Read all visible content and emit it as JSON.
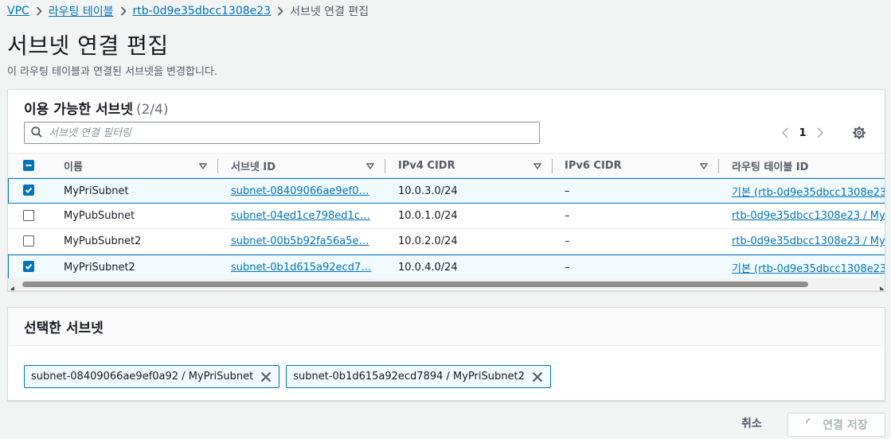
{
  "breadcrumb": {
    "items": [
      "VPC",
      "라우팅 테이블",
      "rtb-0d9e35dbcc1308e23"
    ],
    "current": "서브넷 연결 편집"
  },
  "page": {
    "title": "서브넷 연결 편집",
    "description": "이 라우팅 테이블과 연결된 서브넷을 변경합니다."
  },
  "available": {
    "title": "이용 가능한 서브넷",
    "count": "(2/4)",
    "filter_placeholder": "서브넷 연결 필터링",
    "page": "1",
    "columns": [
      "이름",
      "서브넷 ID",
      "IPv4 CIDR",
      "IPv6 CIDR",
      "라우팅 테이블 ID"
    ],
    "rows": [
      {
        "checked": true,
        "name": "MyPriSubnet",
        "subnet_id": "subnet-08409066ae9ef0…",
        "ipv4": "10.0.3.0/24",
        "ipv6": "–",
        "route": "기본 (rtb-0d9e35dbcc1308e23"
      },
      {
        "checked": false,
        "name": "MyPubSubnet",
        "subnet_id": "subnet-04ed1ce798ed1c…",
        "ipv4": "10.0.1.0/24",
        "ipv6": "–",
        "route": "rtb-0d9e35dbcc1308e23 / My"
      },
      {
        "checked": false,
        "name": "MyPubSubnet2",
        "subnet_id": "subnet-00b5b92fa56a5e…",
        "ipv4": "10.0.2.0/24",
        "ipv6": "–",
        "route": "rtb-0d9e35dbcc1308e23 / My"
      },
      {
        "checked": true,
        "name": "MyPriSubnet2",
        "subnet_id": "subnet-0b1d615a92ecd7…",
        "ipv4": "10.0.4.0/24",
        "ipv6": "–",
        "route": "기본 (rtb-0d9e35dbcc1308e23"
      }
    ]
  },
  "selected": {
    "title": "선택한 서브넷",
    "tokens": [
      "subnet-08409066ae9ef0a92 / MyPriSubnet",
      "subnet-0b1d615a92ecd7894 / MyPriSubnet2"
    ]
  },
  "footer": {
    "cancel_label": "취소",
    "save_label": "연결 저장"
  },
  "colors": {
    "accent": "#0073bb",
    "text": "#16191f",
    "muted": "#545b64",
    "background": "#f2f3f3"
  }
}
